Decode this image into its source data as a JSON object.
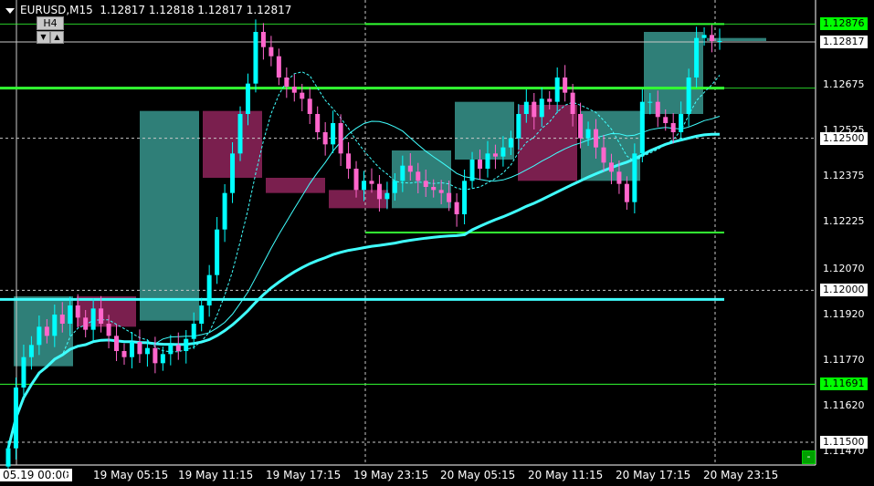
{
  "header": {
    "symbol_info": "EURUSD,M15",
    "ohlc": "1.12817 1.12818 1.12817 1.12817",
    "timeframe_badge": "H4",
    "down_button": "▼",
    "up_button": "▲"
  },
  "price_labels": [
    {
      "text": "1.12876",
      "style": "green",
      "value": 1.12876
    },
    {
      "text": "1.12817",
      "style": "white",
      "value": 1.12817
    },
    {
      "text": "1.12675",
      "style": "plain",
      "value": 1.12675
    },
    {
      "text": "1.12525",
      "style": "plain",
      "value": 1.12525
    },
    {
      "text": "1.12500",
      "style": "white",
      "value": 1.125
    },
    {
      "text": "1.12375",
      "style": "plain",
      "value": 1.12375
    },
    {
      "text": "1.12225",
      "style": "plain",
      "value": 1.12225
    },
    {
      "text": "1.12070",
      "style": "plain",
      "value": 1.1207
    },
    {
      "text": "1.12000",
      "style": "white",
      "value": 1.12
    },
    {
      "text": "1.11920",
      "style": "plain",
      "value": 1.1192
    },
    {
      "text": "1.11770",
      "style": "plain",
      "value": 1.1177
    },
    {
      "text": "1.11691",
      "style": "green",
      "value": 1.11691
    },
    {
      "text": "1.11620",
      "style": "plain",
      "value": 1.1162
    },
    {
      "text": "1.11500",
      "style": "white",
      "value": 1.115
    },
    {
      "text": "1.11470",
      "style": "plain",
      "value": 1.1147
    }
  ],
  "time_labels": [
    {
      "text": "05.19 00:00",
      "highlight": true
    },
    {
      "text": "5",
      "highlight": false
    },
    {
      "text": "19 May 05:15",
      "highlight": false
    },
    {
      "text": "19 May 11:15",
      "highlight": false
    },
    {
      "text": "19 May 17:15",
      "highlight": false
    },
    {
      "text": "19 May 23:15",
      "highlight": false
    },
    {
      "text": "20 May 05:15",
      "highlight": false
    },
    {
      "text": "20 May 11:15",
      "highlight": false
    },
    {
      "text": "20 May 17:15",
      "highlight": false
    },
    {
      "text": "20 May 23:15",
      "highlight": false
    }
  ],
  "minus_button": "-",
  "colors": {
    "background": "#000000",
    "bull_candle": "#00ffff",
    "bear_candle": "#ff66cc",
    "bull_box": "#2f7f78",
    "bear_box": "#7a1f4e",
    "level_green": "#32ff32",
    "ma_cyan": "#40ffff",
    "grid": "#c8c8c8"
  },
  "chart_data": {
    "type": "candlestick",
    "symbol": "EURUSD",
    "timeframe": "M15",
    "ylim": [
      1.11425,
      1.12955
    ],
    "x_tick_labels": [
      "05.19 00:00",
      "19 May 05:15",
      "19 May 11:15",
      "19 May 17:15",
      "19 May 23:15",
      "20 May 05:15",
      "20 May 11:15",
      "20 May 17:15",
      "20 May 23:15"
    ],
    "horizontal_levels": [
      {
        "price": 1.12876,
        "color": "green",
        "style": "solid"
      },
      {
        "price": 1.12817,
        "color": "white",
        "style": "solid"
      },
      {
        "price": 1.12665,
        "color": "green",
        "style": "solid-thick"
      },
      {
        "price": 1.125,
        "color": "white",
        "style": "dashed"
      },
      {
        "price": 1.1219,
        "color": "green",
        "style": "solid"
      },
      {
        "price": 1.12,
        "color": "white",
        "style": "dashed"
      },
      {
        "price": 1.1197,
        "color": "cyan",
        "style": "solid-thick"
      },
      {
        "price": 1.11691,
        "color": "green",
        "style": "solid"
      },
      {
        "price": 1.115,
        "color": "white",
        "style": "dashed"
      }
    ],
    "h4_boxes": [
      {
        "open": 1.1175,
        "close": 1.1198,
        "direction": "bull"
      },
      {
        "open": 1.1198,
        "close": 1.1188,
        "direction": "bear"
      },
      {
        "open": 1.119,
        "close": 1.1259,
        "direction": "bull"
      },
      {
        "open": 1.1259,
        "close": 1.1237,
        "direction": "bear"
      },
      {
        "open": 1.1237,
        "close": 1.1232,
        "direction": "bear"
      },
      {
        "open": 1.1233,
        "close": 1.1227,
        "direction": "bear"
      },
      {
        "open": 1.1227,
        "close": 1.1246,
        "direction": "bull"
      },
      {
        "open": 1.1243,
        "close": 1.1262,
        "direction": "bull"
      },
      {
        "open": 1.1261,
        "close": 1.1236,
        "direction": "bear"
      },
      {
        "open": 1.1236,
        "close": 1.1259,
        "direction": "bull"
      },
      {
        "open": 1.1258,
        "close": 1.1285,
        "direction": "bull"
      },
      {
        "open": 1.1283,
        "close": 1.1282,
        "direction": "bull"
      }
    ],
    "closes": [
      1.1148,
      1.1168,
      1.1178,
      1.1182,
      1.1188,
      1.1185,
      1.1192,
      1.1189,
      1.1195,
      1.1191,
      1.1187,
      1.1194,
      1.1189,
      1.1185,
      1.118,
      1.1178,
      1.1183,
      1.1179,
      1.1181,
      1.1176,
      1.1179,
      1.1182,
      1.118,
      1.1184,
      1.1189,
      1.1195,
      1.1205,
      1.122,
      1.1232,
      1.1245,
      1.1258,
      1.1268,
      1.1285,
      1.128,
      1.1277,
      1.127,
      1.1267,
      1.1265,
      1.1263,
      1.1258,
      1.1252,
      1.1248,
      1.1255,
      1.1245,
      1.124,
      1.1233,
      1.1236,
      1.1235,
      1.123,
      1.1232,
      1.1236,
      1.1241,
      1.1239,
      1.1236,
      1.1234,
      1.1233,
      1.1232,
      1.1229,
      1.1225,
      1.1236,
      1.1243,
      1.124,
      1.1245,
      1.1244,
      1.1247,
      1.125,
      1.1258,
      1.1262,
      1.1257,
      1.1263,
      1.1262,
      1.127,
      1.1265,
      1.1258,
      1.125,
      1.1253,
      1.1247,
      1.1242,
      1.1239,
      1.1235,
      1.1229,
      1.1245,
      1.1262,
      1.1262,
      1.1257,
      1.1255,
      1.1252,
      1.1258,
      1.127,
      1.1283,
      1.1284,
      1.1282,
      1.1282
    ]
  }
}
